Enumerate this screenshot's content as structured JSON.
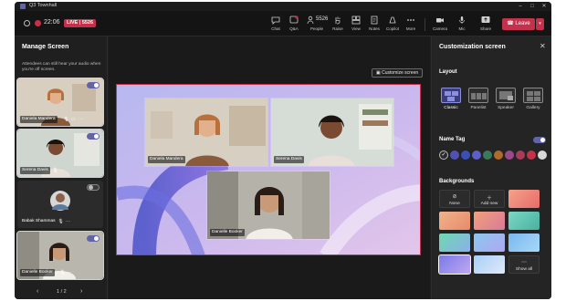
{
  "window": {
    "title": "Q3 Townhall"
  },
  "toolbar": {
    "timer": "22:06",
    "live_badge": "LIVE | 5526",
    "buttons": [
      {
        "label": "Chat",
        "icon": "chat-icon"
      },
      {
        "label": "Q&A",
        "icon": "qa-icon"
      },
      {
        "label": "People",
        "icon": "people-icon",
        "count": "5526"
      },
      {
        "label": "Raise",
        "icon": "raise-hand-icon"
      },
      {
        "label": "View",
        "icon": "view-icon"
      },
      {
        "label": "Notes",
        "icon": "notes-icon"
      },
      {
        "label": "Copilot",
        "icon": "copilot-icon"
      },
      {
        "label": "More",
        "icon": "more-icon"
      },
      {
        "label": "Camera",
        "icon": "camera-icon"
      },
      {
        "label": "Mic",
        "icon": "mic-icon"
      },
      {
        "label": "Share",
        "icon": "share-icon"
      }
    ],
    "leave_label": "Leave"
  },
  "left_panel": {
    "title": "Manage Screen",
    "note": "Attendees can still hear your audio when you're off screen.",
    "participants": [
      {
        "name": "Daniela Mandera",
        "on_screen": true
      },
      {
        "name": "Serena Davis",
        "on_screen": true
      },
      {
        "name": "Babak Shammas",
        "on_screen": false
      },
      {
        "name": "Danielle Booker",
        "on_screen": true
      }
    ],
    "pager": "1 / 2"
  },
  "stage": {
    "customize_button": "Customize screen",
    "speakers": [
      "Daniela Mandera",
      "Serena Davis",
      "Danielle Booker"
    ]
  },
  "right_panel": {
    "title": "Customization screen",
    "layout": {
      "heading": "Layout",
      "options": [
        "Classic",
        "Panelist",
        "Speaker",
        "Gallery"
      ],
      "selected": "Classic"
    },
    "name_tag": {
      "heading": "Name Tag",
      "enabled": true,
      "colors": [
        "#2b2b2b",
        "#4f52b2",
        "#3b4fb8",
        "#5b5fc7",
        "#3a7a5a",
        "#b06a2a",
        "#9a4a8a",
        "#a83a5a",
        "#c4314b",
        "#d9d9d9"
      ]
    },
    "backgrounds": {
      "heading": "Backgrounds",
      "none_label": "None",
      "add_label": "Add new",
      "show_all_label": "Show all"
    }
  },
  "colors": {
    "accent": "#6264a7",
    "leave": "#c4314b",
    "canvas_border": "#c4314b",
    "panel_bg": "#1f1f1f"
  }
}
